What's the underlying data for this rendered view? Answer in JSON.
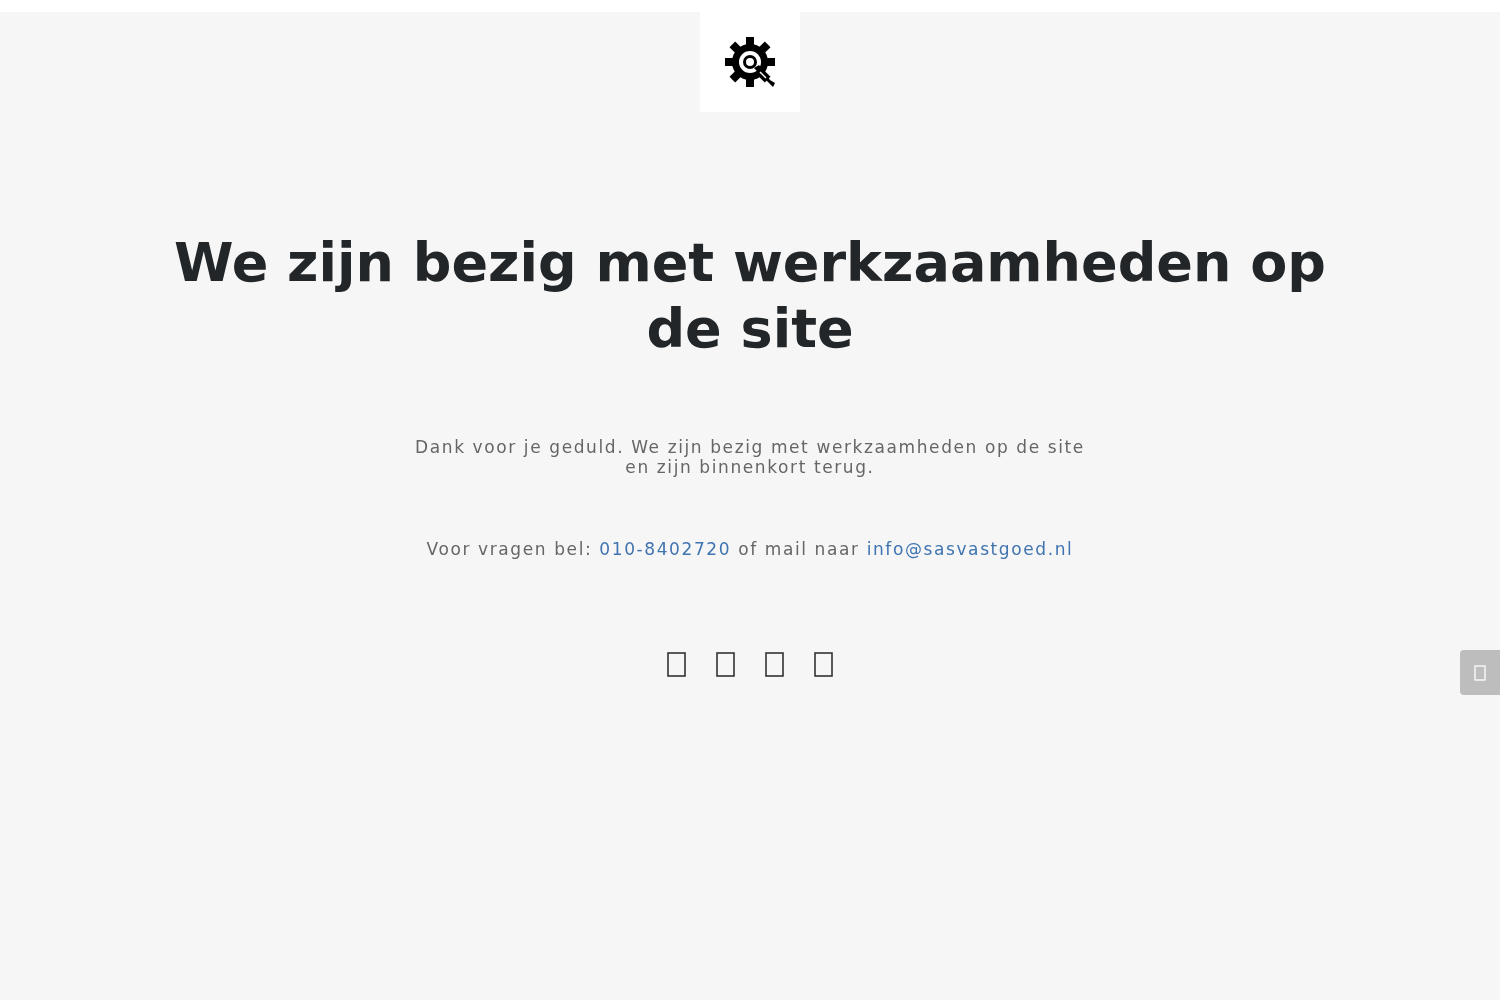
{
  "logo": {
    "kind": "gear-wrench"
  },
  "headline": "We zijn bezig met werkzaamheden op de site",
  "message": "Dank voor je geduld. We zijn bezig met werkzaamheden op de site en zijn binnenkort terug.",
  "contact": [
    {
      "kind": "text",
      "text": "Voor vragen bel: "
    },
    {
      "kind": "link",
      "text": "010-8402720"
    },
    {
      "kind": "text",
      "text": " of mail naar "
    },
    {
      "kind": "link",
      "text": "info@sasvastgoed.nl"
    }
  ],
  "social_links": [
    {
      "kind": "glyph"
    },
    {
      "kind": "glyph"
    },
    {
      "kind": "glyph"
    },
    {
      "kind": "glyph"
    }
  ],
  "side_button": {
    "kind": "glyph"
  }
}
